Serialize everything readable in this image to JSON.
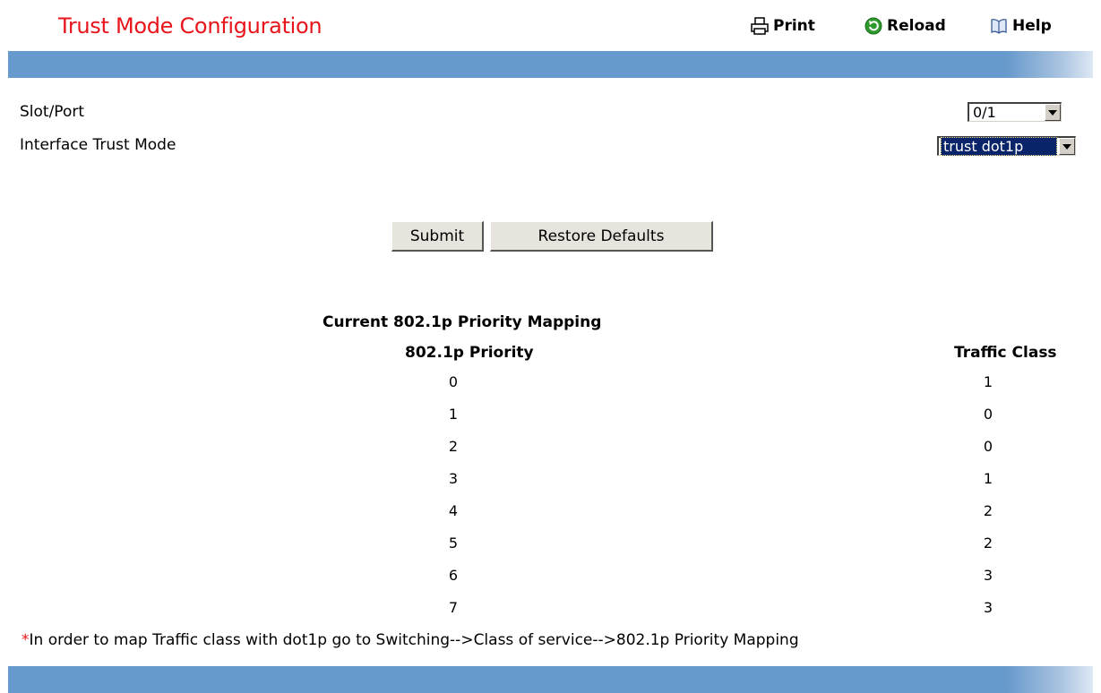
{
  "header": {
    "title": "Trust Mode Configuration",
    "print_label": "Print",
    "reload_label": "Reload",
    "help_label": "Help"
  },
  "form": {
    "slot_port_label": "Slot/Port",
    "slot_port_value": "0/1",
    "trust_mode_label": "Interface Trust Mode",
    "trust_mode_value": "trust dot1p"
  },
  "buttons": {
    "submit_label": "Submit",
    "restore_label": "Restore Defaults"
  },
  "mapping": {
    "caption": "Current 802.1p Priority Mapping",
    "col_priority": "802.1p Priority",
    "col_traffic_class": "Traffic Class",
    "rows": [
      {
        "priority": "0",
        "traffic_class": "1"
      },
      {
        "priority": "1",
        "traffic_class": "0"
      },
      {
        "priority": "2",
        "traffic_class": "0"
      },
      {
        "priority": "3",
        "traffic_class": "1"
      },
      {
        "priority": "4",
        "traffic_class": "2"
      },
      {
        "priority": "5",
        "traffic_class": "2"
      },
      {
        "priority": "6",
        "traffic_class": "3"
      },
      {
        "priority": "7",
        "traffic_class": "3"
      }
    ]
  },
  "footnote": {
    "star": "*",
    "text": "In order to map Traffic class with dot1p go to Switching-->Class of service-->802.1p Priority Mapping"
  },
  "icons": {
    "print": "printer-icon",
    "reload": "reload-icon",
    "help": "help-book-icon"
  },
  "colors": {
    "title": "#e8141b",
    "bar": "#6699cc",
    "selection": "#0a246a"
  }
}
